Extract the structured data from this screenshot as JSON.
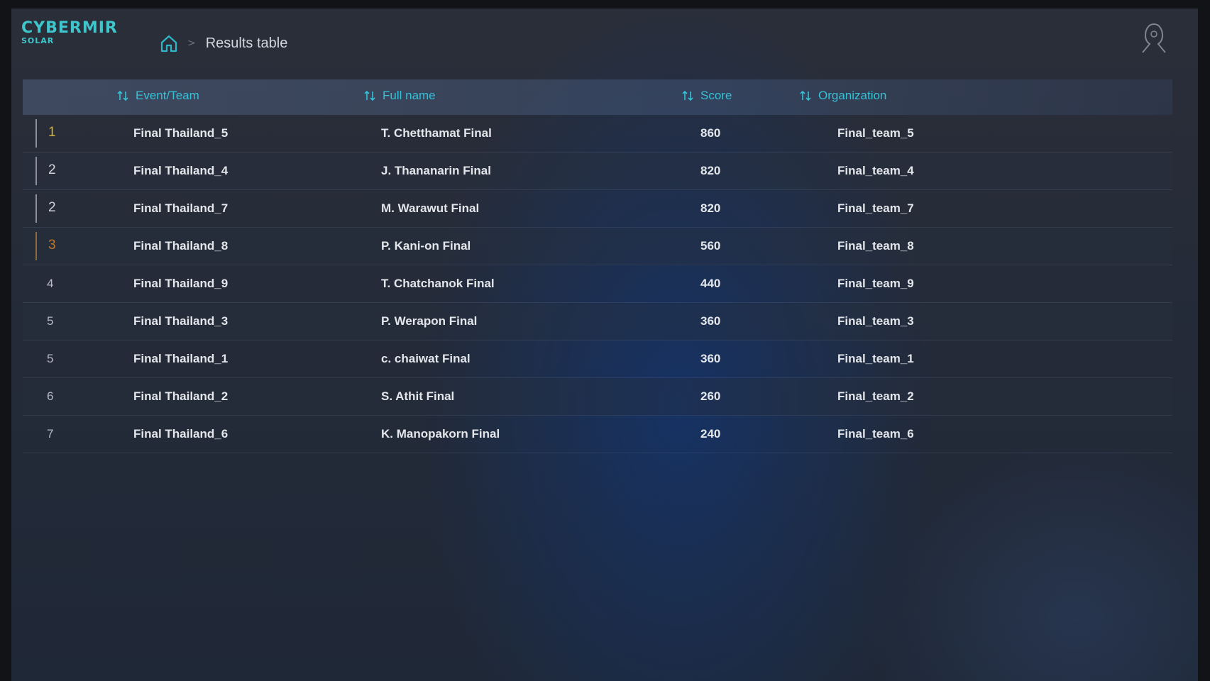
{
  "brand": {
    "name": "CYBERMIR",
    "sub": "SOLAR",
    "accent": "#3ec6cc"
  },
  "breadcrumb": {
    "home_icon": "home-icon",
    "separator": ">",
    "current": "Results table"
  },
  "avatar_icon": "user-avatar-icon",
  "table": {
    "columns": [
      {
        "label": "Event/Team",
        "icon": "sort-icon"
      },
      {
        "label": "Full name",
        "icon": "sort-icon"
      },
      {
        "label": "Score",
        "icon": "sort-icon"
      },
      {
        "label": "Organization",
        "icon": "sort-icon"
      }
    ],
    "rows": [
      {
        "rank": "1",
        "event": "Final Thailand_5",
        "name": "T. Chetthamat Final",
        "score": "860",
        "org": "Final_team_5"
      },
      {
        "rank": "2",
        "event": "Final Thailand_4",
        "name": "J. Thananarin Final",
        "score": "820",
        "org": "Final_team_4"
      },
      {
        "rank": "2",
        "event": "Final Thailand_7",
        "name": "M. Warawut Final",
        "score": "820",
        "org": "Final_team_7"
      },
      {
        "rank": "3",
        "event": "Final Thailand_8",
        "name": "P. Kani-on Final",
        "score": "560",
        "org": "Final_team_8"
      },
      {
        "rank": "4",
        "event": "Final Thailand_9",
        "name": "T. Chatchanok Final",
        "score": "440",
        "org": "Final_team_9"
      },
      {
        "rank": "5",
        "event": "Final Thailand_3",
        "name": "P. Werapon Final",
        "score": "360",
        "org": "Final_team_3"
      },
      {
        "rank": "5",
        "event": "Final Thailand_1",
        "name": "c. chaiwat Final",
        "score": "360",
        "org": "Final_team_1"
      },
      {
        "rank": "6",
        "event": "Final Thailand_2",
        "name": "S. Athit Final",
        "score": "260",
        "org": "Final_team_2"
      },
      {
        "rank": "7",
        "event": "Final Thailand_6",
        "name": "K. Manopakorn Final",
        "score": "240",
        "org": "Final_team_6"
      }
    ]
  },
  "colors": {
    "header_text": "#35c1d6",
    "rank_gold": "#d2b23e",
    "rank_bronze": "#c0762e",
    "row_text": "#e3e6ea"
  }
}
